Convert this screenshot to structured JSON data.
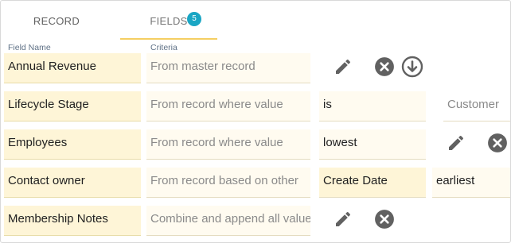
{
  "tabs": [
    {
      "label": "RECORD"
    },
    {
      "label": "FIELDS",
      "badge": "5"
    }
  ],
  "columns": {
    "field_name": "Field Name",
    "criteria": "Criteria"
  },
  "rows": [
    {
      "name": "Annual Revenue",
      "criteria": "From master record",
      "actions": [
        "edit-icon",
        "clear-icon",
        "download-icon"
      ]
    },
    {
      "name": "Lifecycle Stage",
      "criteria": "From record where value",
      "operator": "is",
      "value": "Customer"
    },
    {
      "name": "Employees",
      "criteria": "From record where value",
      "operator": "lowest",
      "actions": [
        "edit-icon",
        "clear-icon"
      ]
    },
    {
      "name": "Contact owner",
      "criteria": "From record based on other",
      "operator": "Create Date",
      "value": "earliest"
    },
    {
      "name": "Membership Notes",
      "criteria": "Combine and append all values",
      "actions": [
        "edit-icon",
        "clear-icon"
      ]
    }
  ],
  "colors": {
    "accent": "#f5cf62",
    "badge": "#1aa6c4",
    "icon": "#616161",
    "field_bg": "#fef5d7"
  }
}
